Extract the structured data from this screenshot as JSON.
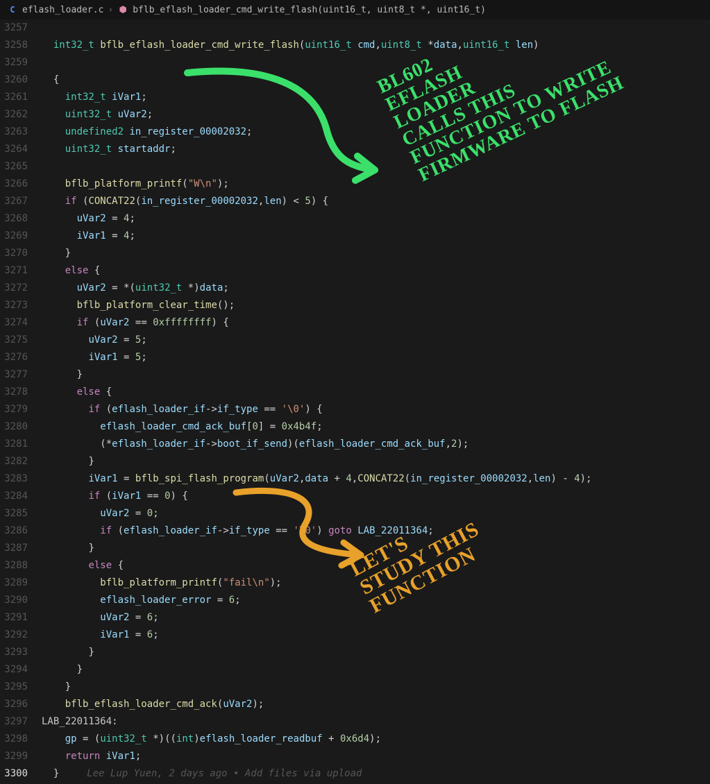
{
  "breadcrumb": {
    "file_icon": "C",
    "file": "eflash_loader.c",
    "sep": "›",
    "symbol_icon": "⬢",
    "symbol": "bflb_eflash_loader_cmd_write_flash(uint16_t, uint8_t *, uint16_t)"
  },
  "lines": {
    "start": 3257,
    "active": 3300
  },
  "gitlens": "Lee Lup Yuen, 2 days ago • Add files via upload",
  "anno_green": "BL602\nEFLASH\nLOADER\nCALLS THIS\nFUNCTION TO WRITE\nFIRMWARE TO FLASH",
  "anno_orange": "LET'S\nSTUDY THIS\nFUNCTION",
  "chart_data": null,
  "code": {
    "signature_ret": "int32_t",
    "signature_name": "bflb_eflash_loader_cmd_write_flash"
  }
}
